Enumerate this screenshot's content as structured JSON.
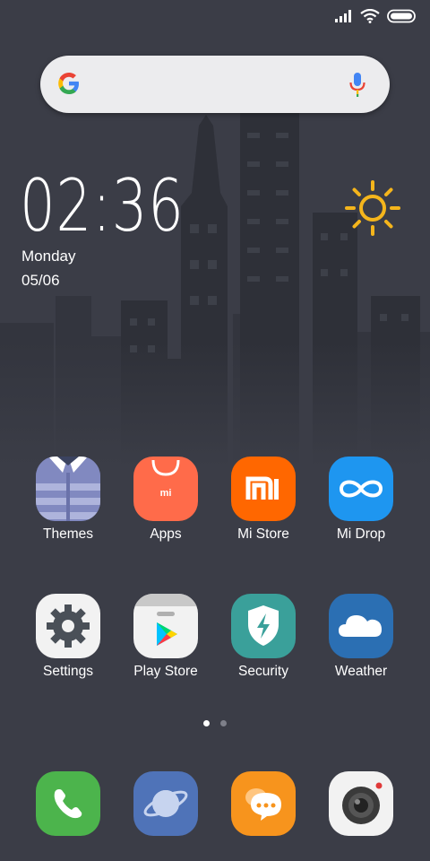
{
  "status_bar": {
    "icons": [
      "signal-icon",
      "wifi-icon",
      "battery-icon"
    ]
  },
  "search_bar": {
    "icons": [
      "google-logo-icon",
      "mic-icon"
    ]
  },
  "clock": {
    "time": "02:36",
    "day": "Monday",
    "date": "05/06"
  },
  "weather_widget": {
    "icon": "sun-icon",
    "color": "#f4b51c"
  },
  "apps": [
    {
      "label": "Themes",
      "icon": "themes-icon"
    },
    {
      "label": "Apps",
      "icon": "apps-icon"
    },
    {
      "label": "Mi Store",
      "icon": "mi-store-icon"
    },
    {
      "label": "Mi Drop",
      "icon": "mi-drop-icon"
    },
    {
      "label": "Settings",
      "icon": "settings-icon"
    },
    {
      "label": "Play Store",
      "icon": "play-store-icon"
    },
    {
      "label": "Security",
      "icon": "security-icon"
    },
    {
      "label": "Weather",
      "icon": "weather-icon"
    }
  ],
  "mi_logo_text": "mi",
  "page_indicator": {
    "pages": 2,
    "active": 1
  },
  "dock": [
    {
      "icon": "phone-icon"
    },
    {
      "icon": "browser-icon"
    },
    {
      "icon": "messages-icon"
    },
    {
      "icon": "camera-icon"
    }
  ],
  "colors": {
    "background": "#3b3d47",
    "mi_orange": "#ff6700",
    "apps_coral": "#ff6b4a",
    "mi_drop_blue": "#1e96f0"
  }
}
